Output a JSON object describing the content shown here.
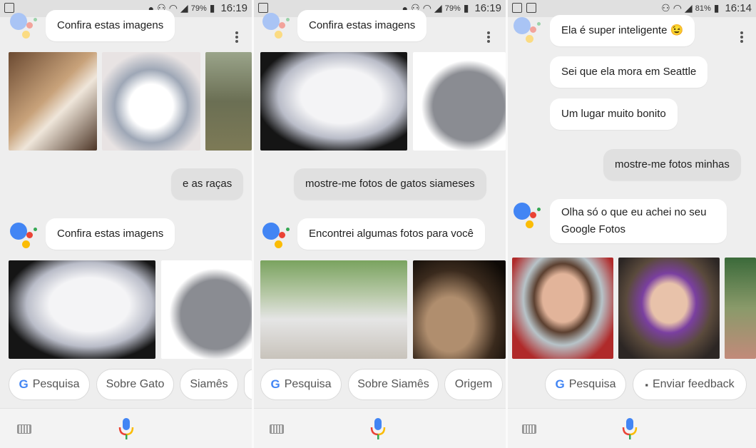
{
  "status": {
    "panel1": {
      "battery": "79%",
      "time": "16:19"
    },
    "panel2": {
      "battery": "79%",
      "time": "16:19"
    },
    "panel3": {
      "battery": "81%",
      "time": "16:14"
    }
  },
  "panel1": {
    "assistant_msg_top": "Confira estas imagens",
    "user_msg": "e as raças",
    "assistant_msg": "Confira estas imagens",
    "chips": [
      "Pesquisa",
      "Sobre Gato",
      "Siamês"
    ]
  },
  "panel2": {
    "assistant_msg_top": "Confira estas imagens",
    "user_msg": "mostre-me fotos de gatos siameses",
    "assistant_msg": "Encontrei algumas fotos para você",
    "chips": [
      "Pesquisa",
      "Sobre Siamês",
      "Origem"
    ]
  },
  "panel3": {
    "msg1": "Ela é super inteligente 😉",
    "msg2": "Sei que ela mora em Seattle",
    "msg3": "Um lugar muito bonito",
    "user_msg": "mostre-me fotos minhas",
    "assistant_msg": "Olha só o que eu achei no seu Google Fotos",
    "chips": [
      "Pesquisa",
      "Enviar feedback"
    ]
  },
  "icons": {
    "keyboard": "keyboard-icon",
    "mic": "microphone-icon",
    "menu": "more-vert-icon",
    "google": "google-g-icon",
    "feedback": "feedback-icon"
  },
  "colors": {
    "blue": "#4285f4",
    "red": "#ea4335",
    "yellow": "#fbbc05",
    "green": "#34a853"
  }
}
